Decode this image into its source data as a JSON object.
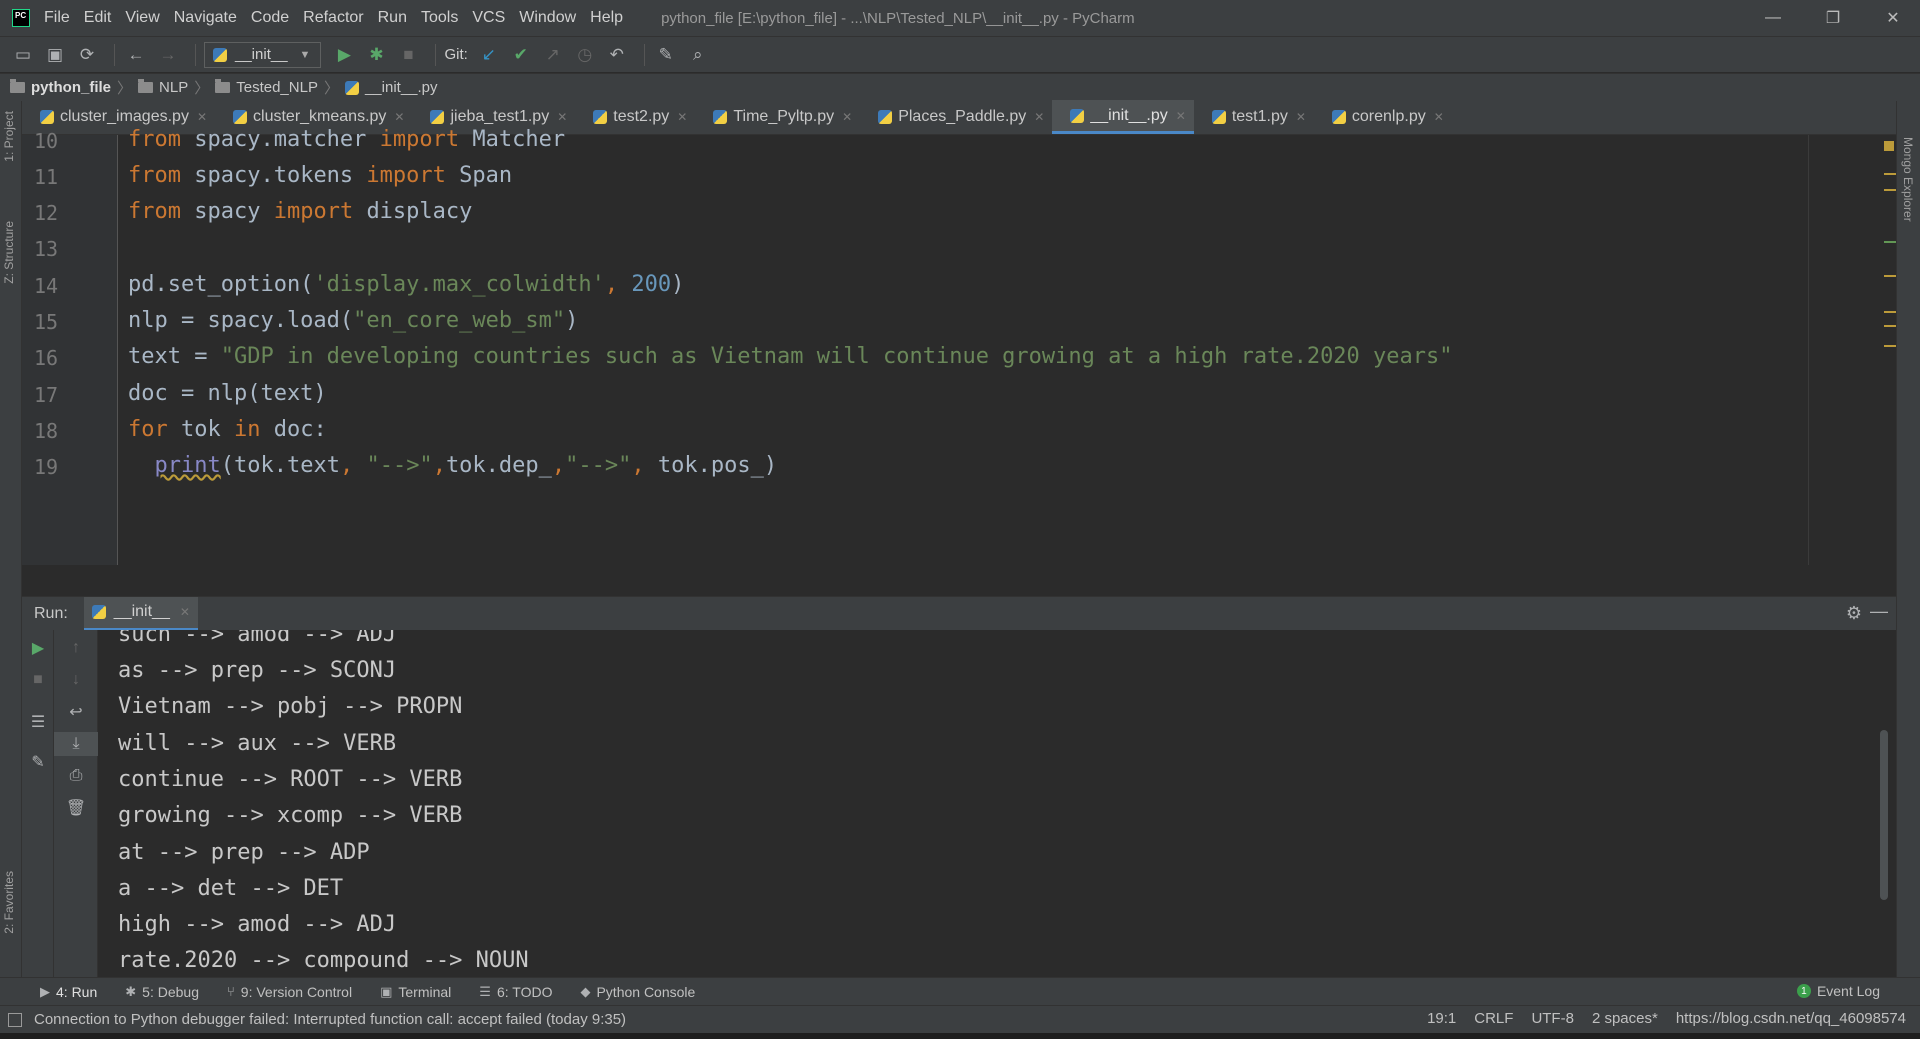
{
  "window": {
    "title": "python_file [E:\\python_file] - ...\\NLP\\Tested_NLP\\__init__.py - PyCharm",
    "minimize": "—",
    "restore": "❐",
    "close": "✕"
  },
  "menu": [
    "File",
    "Edit",
    "View",
    "Navigate",
    "Code",
    "Refactor",
    "Run",
    "Tools",
    "VCS",
    "Window",
    "Help"
  ],
  "toolbar": {
    "run_config": "__init__",
    "git_label": "Git:"
  },
  "breadcrumb": [
    "python_file",
    "NLP",
    "Tested_NLP",
    "__init__.py"
  ],
  "left_tabs": [
    "1: Project",
    "Z: Structure",
    "2: Favorites"
  ],
  "right_tabs": [
    "Mongo Explorer"
  ],
  "editor_tabs": [
    {
      "label": "cluster_images.py",
      "active": false
    },
    {
      "label": "cluster_kmeans.py",
      "active": false
    },
    {
      "label": "jieba_test1.py",
      "active": false
    },
    {
      "label": "test2.py",
      "active": false
    },
    {
      "label": "Time_Pyltp.py",
      "active": false
    },
    {
      "label": "Places_Paddle.py",
      "active": false
    },
    {
      "label": "__init__.py",
      "active": true
    },
    {
      "label": "test1.py",
      "active": false
    },
    {
      "label": "corenlp.py",
      "active": false
    }
  ],
  "editor": {
    "line_numbers": [
      "10",
      "11",
      "12",
      "13",
      "14",
      "15",
      "16",
      "17",
      "18",
      "19"
    ]
  },
  "run_panel": {
    "label": "Run:",
    "tab": "__init__",
    "output": [
      "such --> amod --> ADJ",
      "as --> prep --> SCONJ",
      "Vietnam --> pobj --> PROPN",
      "will --> aux --> VERB",
      "continue --> ROOT --> VERB",
      "growing --> xcomp --> VERB",
      "at --> prep --> ADP",
      "a --> det --> DET",
      "high --> amod --> ADJ",
      "rate.2020 --> compound --> NOUN"
    ]
  },
  "tool_windows": [
    {
      "label": "4: Run",
      "icon": "play-icon",
      "active": true
    },
    {
      "label": "5: Debug",
      "icon": "bug-icon",
      "active": false
    },
    {
      "label": "9: Version Control",
      "icon": "vcs-icon",
      "active": false
    },
    {
      "label": "Terminal",
      "icon": "terminal-icon",
      "active": false
    },
    {
      "label": "6: TODO",
      "icon": "list-icon",
      "active": false
    },
    {
      "label": "Python Console",
      "icon": "python-icon",
      "active": false
    }
  ],
  "event_log": {
    "label": "Event Log",
    "count": "1"
  },
  "status": {
    "message": "Connection to Python debugger failed: Interrupted function call: accept failed (today 9:35)",
    "position": "19:1",
    "line_sep": "CRLF",
    "encoding": "UTF-8",
    "indent": "2 spaces*",
    "watermark": "https://blog.csdn.net/qq_46098574"
  },
  "colors": {
    "background": "#2b2b2b",
    "panel": "#3c3f41",
    "keyword": "#cc7832",
    "string": "#6a8759",
    "number": "#6897bb",
    "accent": "#4a88c7"
  }
}
